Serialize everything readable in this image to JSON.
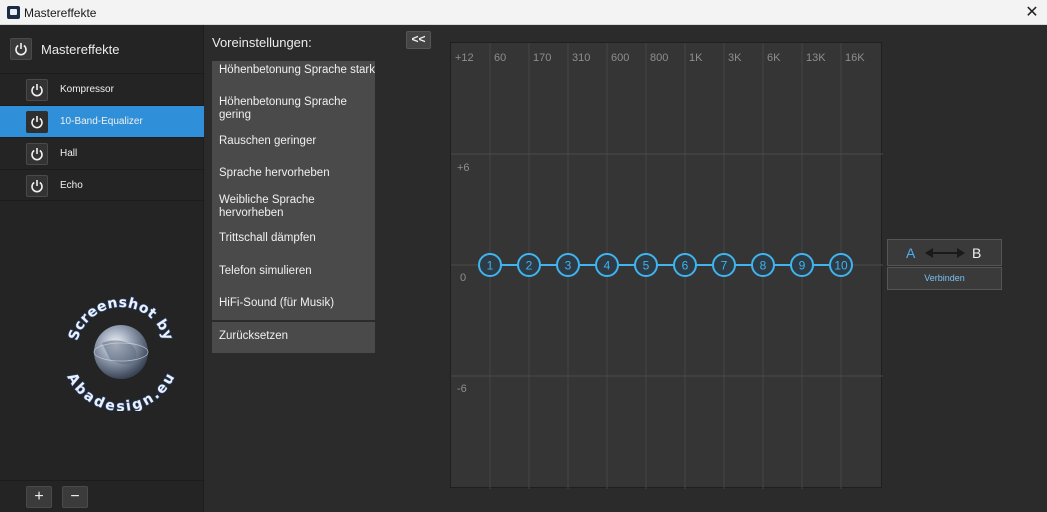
{
  "window": {
    "title": "Mastereffekte",
    "close_symbol": "✕"
  },
  "left_panel": {
    "header_label": "Mastereffekte",
    "effects": [
      {
        "label": "Kompressor",
        "active": false
      },
      {
        "label": "10-Band-Equalizer",
        "active": true
      },
      {
        "label": "Hall",
        "active": false
      },
      {
        "label": "Echo",
        "active": false
      }
    ],
    "add_label": "+",
    "remove_label": "−"
  },
  "watermark": {
    "top_text": "Screenshot by",
    "bottom_text": "Abadesign.eu"
  },
  "presets": {
    "heading": "Voreinstellungen:",
    "collapse_label": "<<",
    "items": [
      "Höhenbetonung Sprache stark",
      "Höhenbetonung Sprache gering",
      "Rauschen geringer",
      "Sprache hervorheben",
      "Weibliche Sprache hervorheben",
      "Trittschall dämpfen",
      "Telefon simulieren",
      "HiFi-Sound (für Musik)"
    ],
    "reset_label": "Zurücksetzen"
  },
  "equalizer": {
    "frequency_labels": [
      "+12",
      "60",
      "170",
      "310",
      "600",
      "800",
      "1K",
      "3K",
      "6K",
      "13K",
      "16K"
    ],
    "gain_labels": [
      "+6",
      "0",
      "-6"
    ],
    "bands": [
      {
        "label": "1",
        "gain": 0
      },
      {
        "label": "2",
        "gain": 0
      },
      {
        "label": "3",
        "gain": 0
      },
      {
        "label": "4",
        "gain": 0
      },
      {
        "label": "5",
        "gain": 0
      },
      {
        "label": "6",
        "gain": 0
      },
      {
        "label": "7",
        "gain": 0
      },
      {
        "label": "8",
        "gain": 0
      },
      {
        "label": "9",
        "gain": 0
      },
      {
        "label": "10",
        "gain": 0
      }
    ],
    "accent_color": "#3fb4ee"
  },
  "ab_compare": {
    "a_label": "A",
    "b_label": "B",
    "connect_label": "Verbinden"
  }
}
